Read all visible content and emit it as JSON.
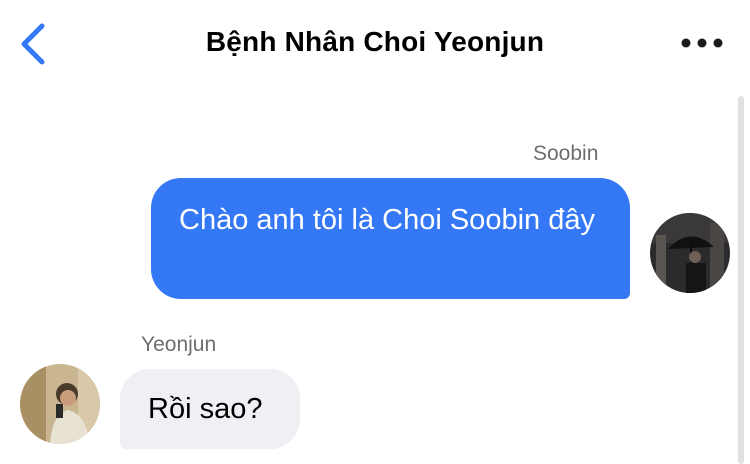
{
  "header": {
    "title": "Bệnh Nhân Choi Yeonjun",
    "back_icon": "chevron-left-icon",
    "more_icon": "more-horizontal-icon",
    "accent_color": "#3478f6"
  },
  "messages": [
    {
      "direction": "outgoing",
      "sender": "Soobin",
      "text": "Chào anh tôi là Choi Soobin đây",
      "bubble_color": "#3478f6"
    },
    {
      "direction": "incoming",
      "sender": "Yeonjun",
      "text": "Rồi sao?",
      "bubble_color": "#efeff4"
    }
  ]
}
